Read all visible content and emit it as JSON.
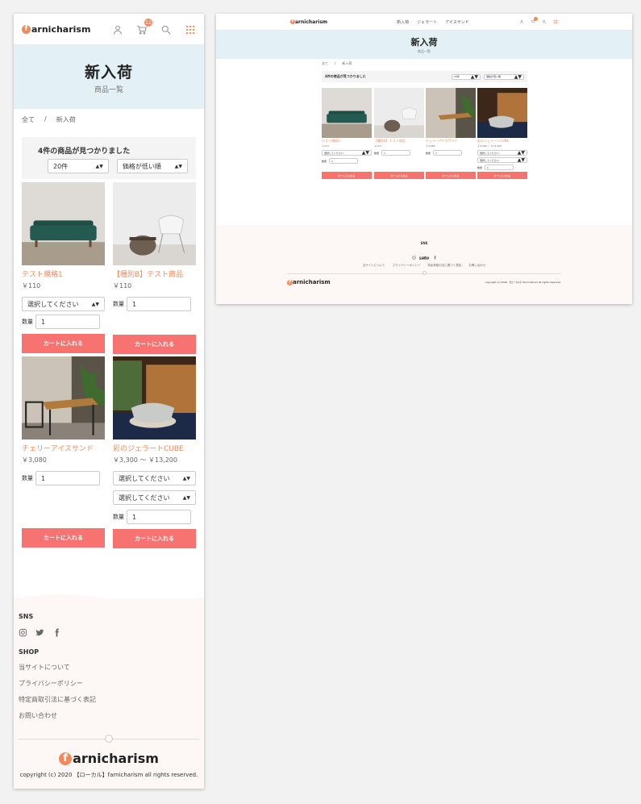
{
  "brand": {
    "logo_letter": "f",
    "logo_rest": "arnicharism"
  },
  "header": {
    "cart_count": "12"
  },
  "nav": {
    "items": [
      "新入荷",
      "ジェラート",
      "アイスサンド"
    ]
  },
  "hero": {
    "title": "新入荷",
    "subtitle": "商品一覧"
  },
  "breadcrumb": {
    "root": "全て",
    "sep": "/",
    "current": "新入荷"
  },
  "filter": {
    "count_text": "4件の商品が見つかりました",
    "per_page": "20件",
    "sort": "価格が低い順"
  },
  "products": [
    {
      "name": "テスト規格1",
      "price": "￥110"
    },
    {
      "name": "【種別B】テスト商品",
      "price": "￥110"
    },
    {
      "name": "チェリーアイスサンド",
      "price": "￥3,080"
    },
    {
      "name": "彩のジェラートCUBE",
      "price": "￥3,300 ～ ￥13,200"
    }
  ],
  "labels": {
    "select_placeholder": "選択してください",
    "quantity": "数量",
    "quantity_value": "1",
    "add_to_cart": "カートに入れる"
  },
  "footer": {
    "sns_title": "SNS",
    "shop_title": "SHOP",
    "links": [
      "当サイトについて",
      "プライバシーポリシー",
      "特定商取引法に基づく表記",
      "お問い合わせ"
    ],
    "copyright": "copyright (c) 2020 【ローカル】farnicharism all rights reserved."
  },
  "colors": {
    "accent": "#f08a5d",
    "button": "#f77372",
    "hero_bg": "#e3f1f6",
    "footer_bg": "#fdf8f5"
  }
}
